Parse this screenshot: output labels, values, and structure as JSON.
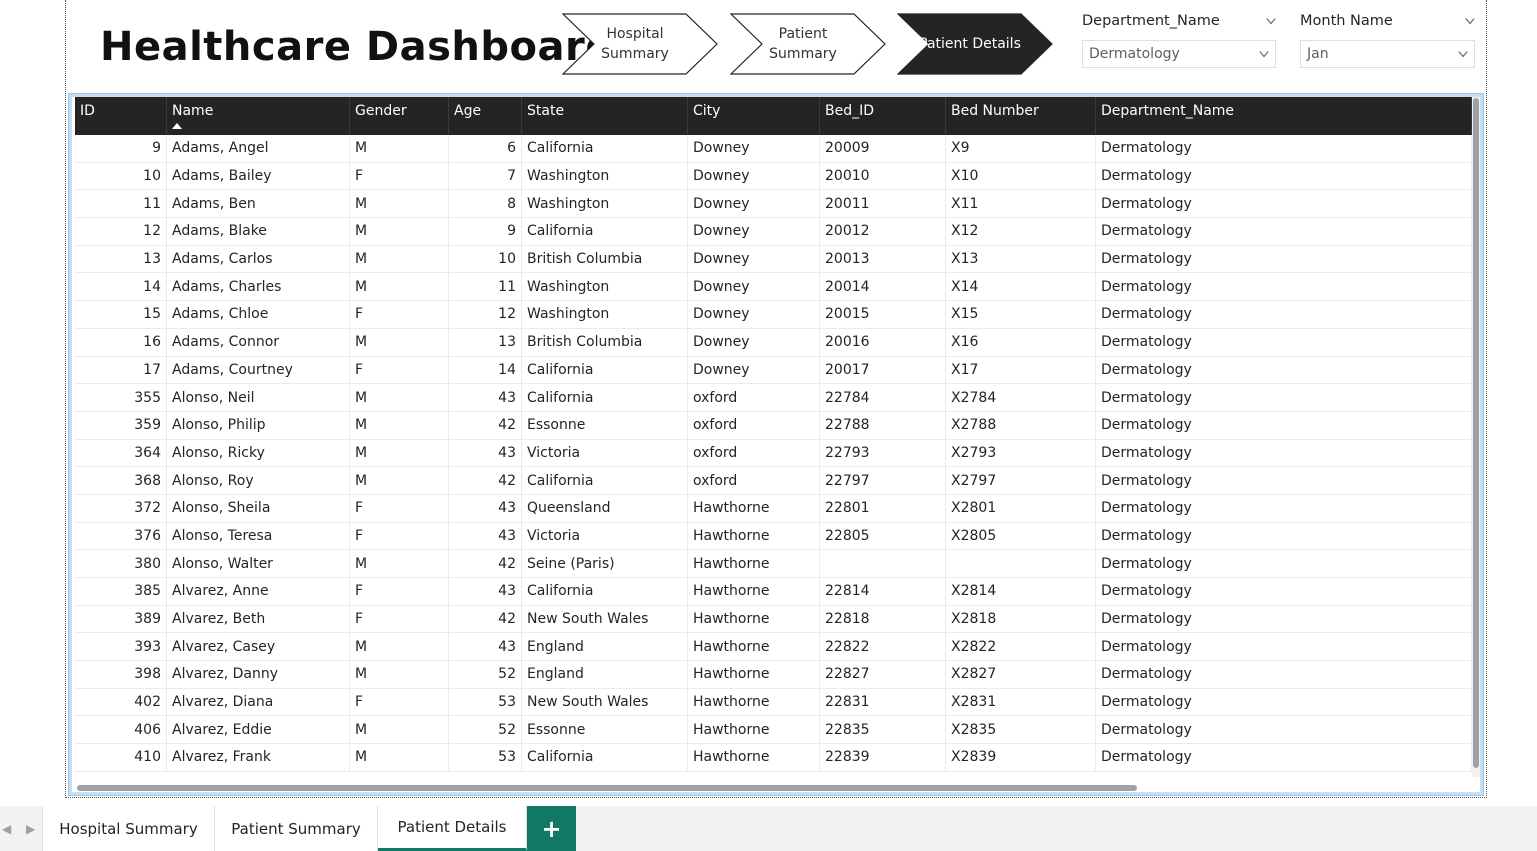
{
  "dashboard": {
    "title": "Healthcare Dashboard"
  },
  "nav": [
    {
      "label": "Hospital\nSummary",
      "active": false
    },
    {
      "label": "Patient\nSummary",
      "active": false
    },
    {
      "label": "Patient Details",
      "active": true
    }
  ],
  "slicers": [
    {
      "title": "Department_Name",
      "value": "Dermatology"
    },
    {
      "title": "Month Name",
      "value": "Jan"
    }
  ],
  "table": {
    "columns": [
      "ID",
      "Name",
      "Gender",
      "Age",
      "State",
      "City",
      "Bed_ID",
      "Bed Number",
      "Department_Name"
    ],
    "sorted_column": "Name",
    "rows": [
      [
        "9",
        "Adams, Angel",
        "M",
        "6",
        "California",
        "Downey",
        "20009",
        "X9",
        "Dermatology"
      ],
      [
        "10",
        "Adams, Bailey",
        "F",
        "7",
        "Washington",
        "Downey",
        "20010",
        "X10",
        "Dermatology"
      ],
      [
        "11",
        "Adams, Ben",
        "M",
        "8",
        "Washington",
        "Downey",
        "20011",
        "X11",
        "Dermatology"
      ],
      [
        "12",
        "Adams, Blake",
        "M",
        "9",
        "California",
        "Downey",
        "20012",
        "X12",
        "Dermatology"
      ],
      [
        "13",
        "Adams, Carlos",
        "M",
        "10",
        "British Columbia",
        "Downey",
        "20013",
        "X13",
        "Dermatology"
      ],
      [
        "14",
        "Adams, Charles",
        "M",
        "11",
        "Washington",
        "Downey",
        "20014",
        "X14",
        "Dermatology"
      ],
      [
        "15",
        "Adams, Chloe",
        "F",
        "12",
        "Washington",
        "Downey",
        "20015",
        "X15",
        "Dermatology"
      ],
      [
        "16",
        "Adams, Connor",
        "M",
        "13",
        "British Columbia",
        "Downey",
        "20016",
        "X16",
        "Dermatology"
      ],
      [
        "17",
        "Adams, Courtney",
        "F",
        "14",
        "California",
        "Downey",
        "20017",
        "X17",
        "Dermatology"
      ],
      [
        "355",
        "Alonso, Neil",
        "M",
        "43",
        "California",
        "oxford",
        "22784",
        "X2784",
        "Dermatology"
      ],
      [
        "359",
        "Alonso, Philip",
        "M",
        "42",
        "Essonne",
        "oxford",
        "22788",
        "X2788",
        "Dermatology"
      ],
      [
        "364",
        "Alonso, Ricky",
        "M",
        "43",
        "Victoria",
        "oxford",
        "22793",
        "X2793",
        "Dermatology"
      ],
      [
        "368",
        "Alonso, Roy",
        "M",
        "42",
        "California",
        "oxford",
        "22797",
        "X2797",
        "Dermatology"
      ],
      [
        "372",
        "Alonso, Sheila",
        "F",
        "43",
        "Queensland",
        "Hawthorne",
        "22801",
        "X2801",
        "Dermatology"
      ],
      [
        "376",
        "Alonso, Teresa",
        "F",
        "43",
        "Victoria",
        "Hawthorne",
        "22805",
        "X2805",
        "Dermatology"
      ],
      [
        "380",
        "Alonso, Walter",
        "M",
        "42",
        "Seine (Paris)",
        "Hawthorne",
        "",
        "",
        "Dermatology"
      ],
      [
        "385",
        "Alvarez, Anne",
        "F",
        "43",
        "California",
        "Hawthorne",
        "22814",
        "X2814",
        "Dermatology"
      ],
      [
        "389",
        "Alvarez, Beth",
        "F",
        "42",
        "New South Wales",
        "Hawthorne",
        "22818",
        "X2818",
        "Dermatology"
      ],
      [
        "393",
        "Alvarez, Casey",
        "M",
        "43",
        "England",
        "Hawthorne",
        "22822",
        "X2822",
        "Dermatology"
      ],
      [
        "398",
        "Alvarez, Danny",
        "M",
        "52",
        "England",
        "Hawthorne",
        "22827",
        "X2827",
        "Dermatology"
      ],
      [
        "402",
        "Alvarez, Diana",
        "F",
        "53",
        "New South Wales",
        "Hawthorne",
        "22831",
        "X2831",
        "Dermatology"
      ],
      [
        "406",
        "Alvarez, Eddie",
        "M",
        "52",
        "Essonne",
        "Hawthorne",
        "22835",
        "X2835",
        "Dermatology"
      ],
      [
        "410",
        "Alvarez, Frank",
        "M",
        "53",
        "California",
        "Hawthorne",
        "22839",
        "X2839",
        "Dermatology"
      ]
    ]
  },
  "page_tabs": [
    {
      "label": "Hospital Summary",
      "active": false
    },
    {
      "label": "Patient Summary",
      "active": false
    },
    {
      "label": "Patient Details",
      "active": true
    }
  ],
  "add_tab_label": "+",
  "colors": {
    "header_bg": "#252423",
    "accent": "#117865",
    "table_border": "#9dc3e6"
  },
  "icons": [
    "chevron-down-icon",
    "chevron-left-icon",
    "chevron-right-icon",
    "sort-ascending-icon",
    "plus-icon"
  ]
}
